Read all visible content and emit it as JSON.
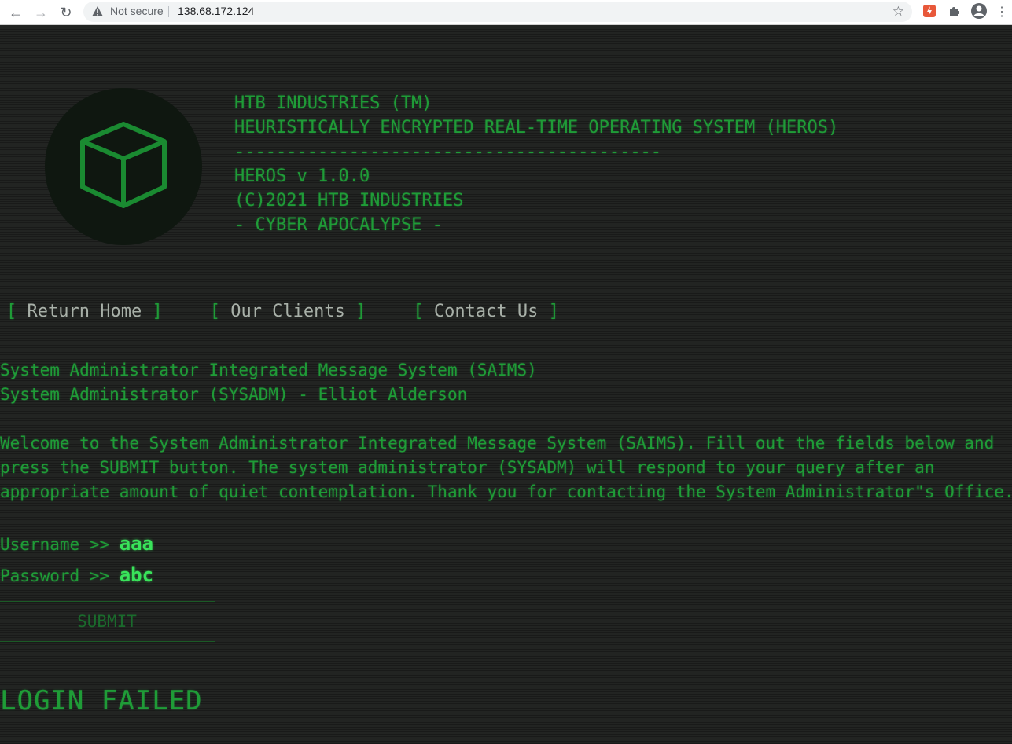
{
  "browser": {
    "security_label": "Not secure",
    "url": "138.68.172.124"
  },
  "header": {
    "lines": [
      "HTB INDUSTRIES (TM)",
      "HEURISTICALLY ENCRYPTED REAL-TIME OPERATING SYSTEM (HEROS)",
      "-----------------------------------------",
      "HEROS v 1.0.0",
      "(C)2021 HTB INDUSTRIES",
      "- CYBER APOCALYPSE -"
    ]
  },
  "nav": {
    "items": [
      {
        "label": "Return Home"
      },
      {
        "label": "Our Clients"
      },
      {
        "label": "Contact Us"
      }
    ]
  },
  "intro": {
    "line1": "System Administrator Integrated Message System (SAIMS)",
    "line2": "System Administrator (SYSADM) - Elliot Alderson"
  },
  "welcome": {
    "line1": "Welcome to the System Administrator Integrated Message System (SAIMS). Fill out the fields below and",
    "line2": "press the SUBMIT button. The system administrator (SYSADM) will respond to your query after an",
    "line3": "appropriate amount of quiet contemplation. Thank you for contacting the System Administrator\"s Office."
  },
  "form": {
    "username_label": "Username >> ",
    "username_value": "aaa",
    "password_label": "Password >> ",
    "password_value": "abc",
    "submit_label": "SUBMIT"
  },
  "status": {
    "message": "LOGIN FAILED"
  },
  "colors": {
    "terminal_green": "#1f9c37",
    "input_green": "#39e35a",
    "background": "#222422"
  }
}
